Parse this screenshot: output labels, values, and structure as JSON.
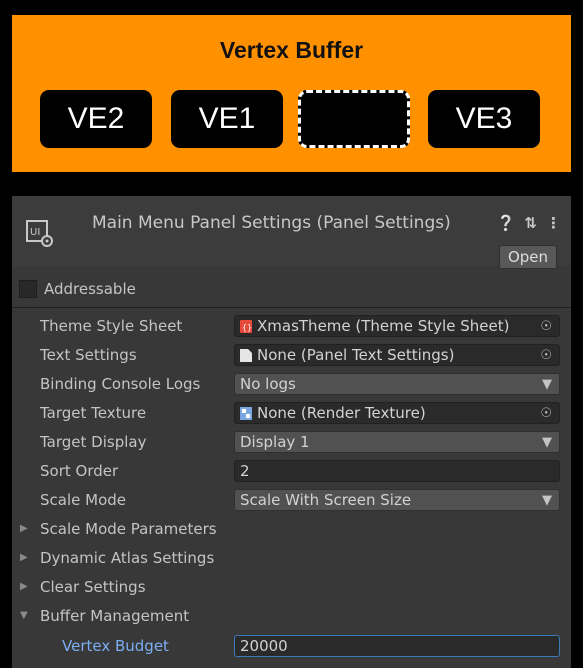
{
  "diagram": {
    "title": "Vertex Buffer",
    "slots": [
      "VE2",
      "VE1",
      "",
      "VE3"
    ],
    "background": "#FF9100"
  },
  "inspector": {
    "title": "Main Menu Panel Settings (Panel Settings)",
    "open_label": "Open",
    "addressable_label": "Addressable",
    "addressable_checked": false,
    "fields": {
      "theme_style_sheet": {
        "label": "Theme Style Sheet",
        "value": "XmasTheme (Theme Style Sheet)",
        "icon": "style-sheet-icon"
      },
      "text_settings": {
        "label": "Text Settings",
        "value": "None (Panel Text Settings)",
        "icon": "document-icon"
      },
      "binding_console_logs": {
        "label": "Binding Console Logs",
        "value": "No logs"
      },
      "target_texture": {
        "label": "Target Texture",
        "value": "None (Render Texture)",
        "icon": "render-texture-icon"
      },
      "target_display": {
        "label": "Target Display",
        "value": "Display 1"
      },
      "sort_order": {
        "label": "Sort Order",
        "value": "2"
      },
      "scale_mode": {
        "label": "Scale Mode",
        "value": "Scale With Screen Size"
      }
    },
    "foldouts": {
      "scale_mode_parameters": "Scale Mode Parameters",
      "dynamic_atlas_settings": "Dynamic Atlas Settings",
      "clear_settings": "Clear Settings",
      "buffer_management": "Buffer Management"
    },
    "vertex_budget": {
      "label": "Vertex Budget",
      "value": "20000"
    }
  }
}
